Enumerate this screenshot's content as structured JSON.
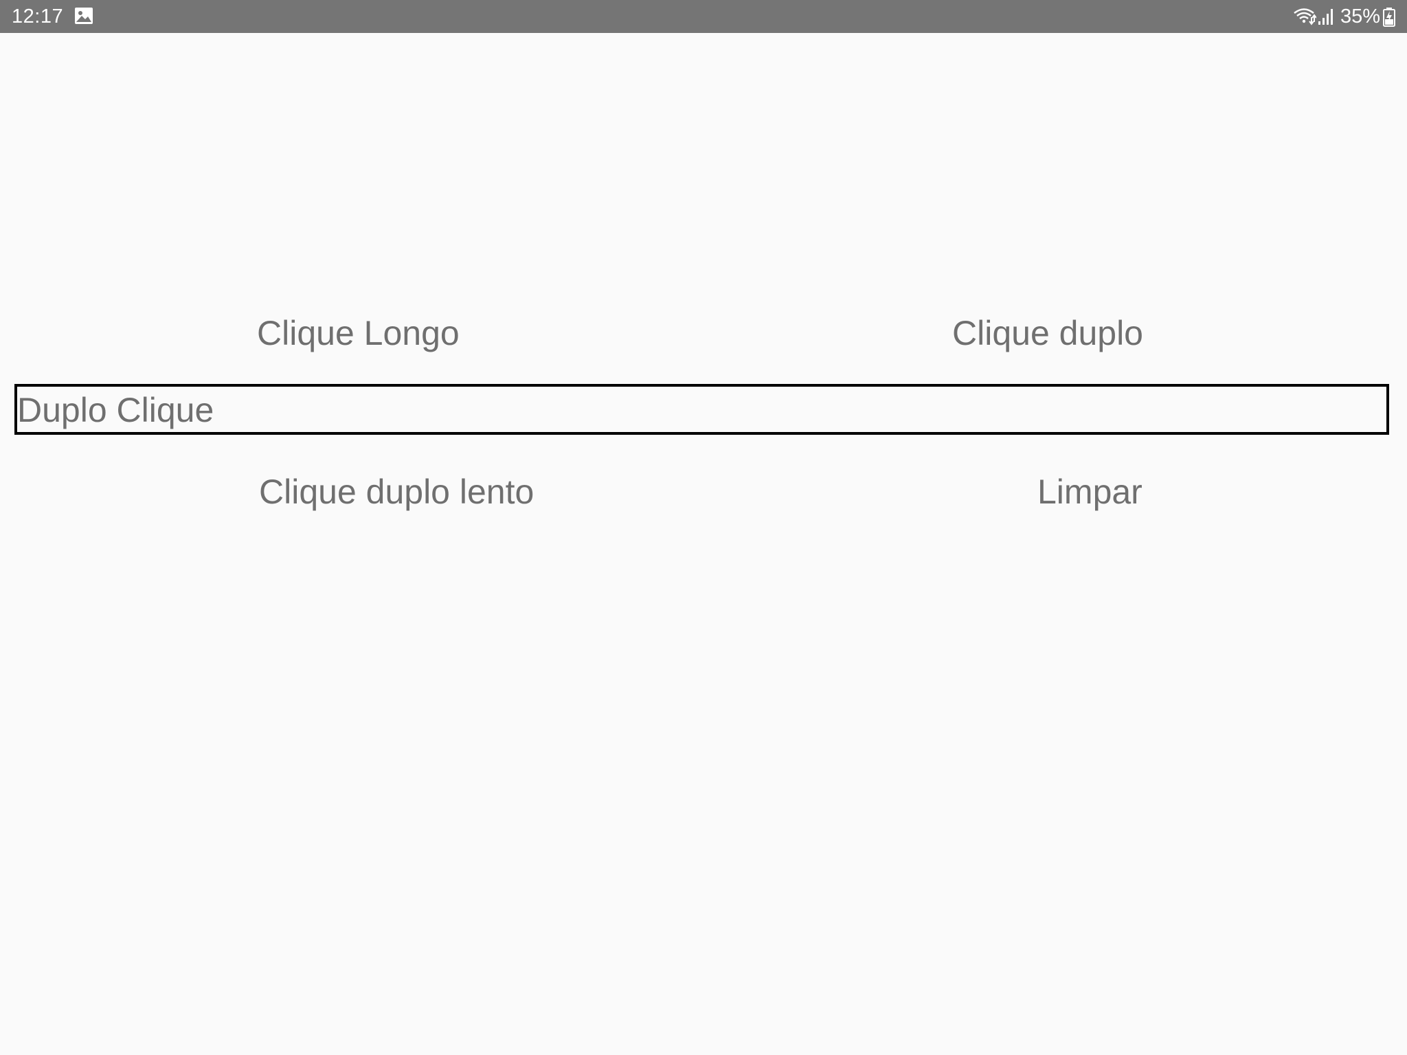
{
  "status_bar": {
    "time": "12:17",
    "battery_percent": "35%",
    "icons": [
      "gallery-icon",
      "wifi-icon",
      "signal-icon",
      "battery-charging-icon"
    ]
  },
  "buttons": {
    "long_click": "Clique Longo",
    "double_click": "Clique duplo",
    "slow_double_click": "Clique duplo lento",
    "clear": "Limpar"
  },
  "output_field": {
    "value": "Duplo Clique"
  },
  "colors": {
    "status_bar_bg": "#757575",
    "background": "#fafafa",
    "button_text": "#6f6f6f",
    "field_border": "#000000"
  }
}
